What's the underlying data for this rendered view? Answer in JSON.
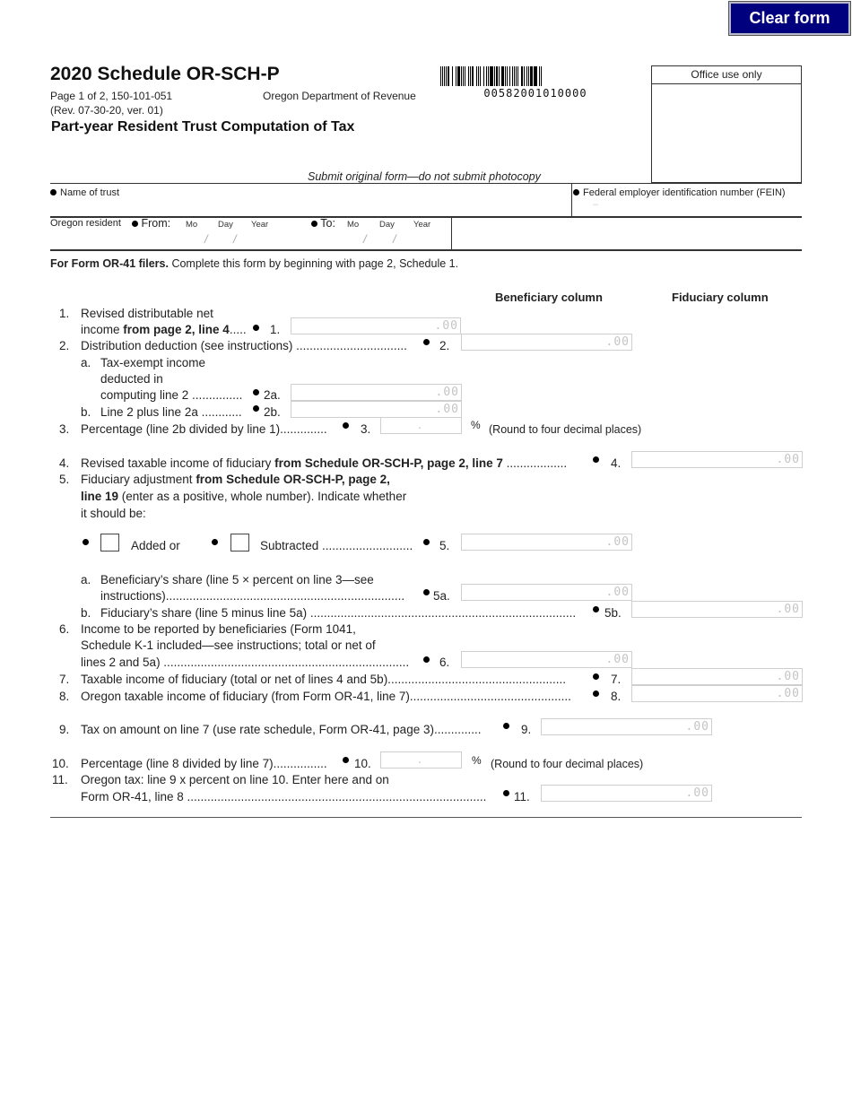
{
  "toolbar": {
    "clear_form_label": "Clear form"
  },
  "header": {
    "title": "2020 Schedule OR-SCH-P",
    "page_info": "Page 1 of 2, 150-101-051",
    "revision": "(Rev. 07-30-20, ver. 01)",
    "department": "Oregon Department of Revenue",
    "subtitle": "Part-year Resident Trust Computation of Tax",
    "barcode_number": "00582001010000",
    "office_use_label": "Office use only",
    "submit_note": "Submit original form—do not submit photocopy"
  },
  "identity": {
    "name_label": "Name of trust",
    "name_value": "",
    "fein_label": "Federal employer identification number (FEIN)",
    "fein_value": "–",
    "resident_label": "Oregon resident",
    "from_label": "From:",
    "to_label": "To:",
    "mo_label": "Mo",
    "day_label": "Day",
    "year_label": "Year",
    "date_sep": "/"
  },
  "intro": {
    "bold": "For Form OR-41 filers.",
    "text": " Complete this form by beginning with page 2, Schedule 1."
  },
  "columns": {
    "beneficiary": "Beneficiary column",
    "fiduciary": "Fiduciary column"
  },
  "lines": {
    "l1": {
      "n": "1.",
      "a": "Revised distributable net",
      "b1": "income ",
      "bold": "from page 2, line 4",
      "dots": ".....",
      "ref": "1.",
      "value": ".00"
    },
    "l2": {
      "n": "2.",
      "text": "Distribution deduction (see instructions) .................................",
      "ref": "2.",
      "value": ".00"
    },
    "l2a": {
      "n": "a.",
      "t1": "Tax-exempt income",
      "t2": "deducted in",
      "t3": "computing line 2 ...............",
      "ref": "2a.",
      "value": ".00"
    },
    "l2b": {
      "n": "b.",
      "text": "Line 2 plus line 2a ............",
      "ref": "2b.",
      "value": ".00"
    },
    "l3": {
      "n": "3.",
      "text": "Percentage (line 2b divided by line 1)..............",
      "ref": "3.",
      "value": ".",
      "pct": "%",
      "note": "(Round to four decimal places)"
    },
    "l4": {
      "n": "4.",
      "t1": "Revised taxable income of fiduciary ",
      "bold": "from Schedule OR-SCH-P, page 2, line 7",
      "dots": " ..................",
      "ref": "4.",
      "value": ".00"
    },
    "l5": {
      "n": "5.",
      "t1": "Fiduciary adjustment ",
      "bold1": "from Schedule OR-SCH-P, page 2,",
      "bold2": "line 19",
      "t2": " (enter as a positive, whole number). Indicate whether",
      "t3": "it should be:",
      "added": "Added  or",
      "subtracted": "Subtracted ...........................",
      "ref": "5.",
      "value": ".00",
      "added_checked": false,
      "subtracted_checked": false
    },
    "l5a": {
      "n": "a.",
      "t1": "Beneficiary’s share (line 5 × percent on line 3—see",
      "t2": "instructions).......................................................................",
      "ref": "5a.",
      "value": ".00"
    },
    "l5b": {
      "n": "b.",
      "text": "Fiduciary’s share (line 5 minus line 5a) ...............................................................................",
      "ref": "5b.",
      "value": ".00"
    },
    "l6": {
      "n": "6.",
      "t1": "Income to be reported by beneficiaries (Form 1041,",
      "t2": "Schedule K-1 included—see instructions; total or net of",
      "t3": "lines 2 and 5a) .........................................................................",
      "ref": "6.",
      "value": ".00"
    },
    "l7": {
      "n": "7.",
      "text": "Taxable income of fiduciary (total or net of lines 4 and 5b).....................................................",
      "ref": "7.",
      "value": ".00"
    },
    "l8": {
      "n": "8.",
      "text": "Oregon taxable income of fiduciary (from Form OR-41, line 7)................................................",
      "ref": "8.",
      "value": ".00"
    },
    "l9": {
      "n": "9.",
      "text": "Tax on amount on line 7 (use rate schedule, Form OR-41, page 3)..............",
      "ref": "9.",
      "value": ".00"
    },
    "l10": {
      "n": "10.",
      "text": "Percentage (line 8 divided by line 7)................",
      "ref": "10.",
      "value": ".",
      "pct": "%",
      "note": "(Round to four decimal places)"
    },
    "l11": {
      "n": "11.",
      "t1": "Oregon tax: line 9 x percent on line 10. Enter here and on",
      "t2": "Form OR-41, line 8 .........................................................................................",
      "ref": "11.",
      "value": ".00"
    }
  }
}
